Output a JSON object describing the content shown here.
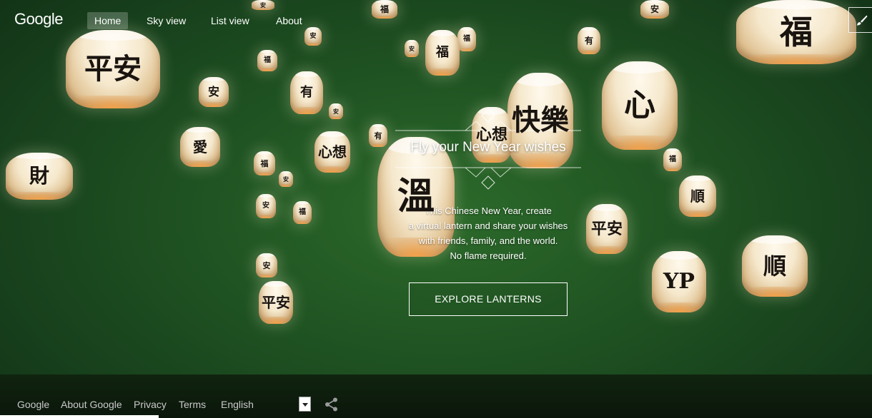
{
  "app": {
    "logo": "Google"
  },
  "nav": {
    "items": [
      {
        "label": "Home",
        "active": true
      },
      {
        "label": "Sky view",
        "active": false
      },
      {
        "label": "List view",
        "active": false
      },
      {
        "label": "About",
        "active": false
      }
    ],
    "draw_icon": "brush-icon"
  },
  "hero": {
    "title": "Fly your New Year wishes",
    "description": [
      "This Chinese New Year, create",
      "a virtual lantern and share your wishes",
      "with friends, family, and the world.",
      "No flame required."
    ],
    "cta_label": "EXPLORE LANTERNS"
  },
  "lanterns": {
    "l1": "平安",
    "l2": "福",
    "l3": "溫",
    "l4": "心",
    "l5": "YP",
    "l6": "平安",
    "l7": "順",
    "l8": "快樂",
    "l9": "福",
    "l10": "安",
    "l11": "財",
    "l12": "愛",
    "l13": "有",
    "l14": "心想",
    "l15": "平安",
    "l16": "平安",
    "l17": "福"
  },
  "footer": {
    "links": [
      "Google",
      "About Google",
      "Privacy",
      "Terms"
    ],
    "language": "English",
    "share_icon": "share-icon"
  },
  "colors": {
    "sky_center": "#2c6a2a",
    "sky_edge": "#102d14",
    "text": "#ffffff",
    "footer_text": "#c9c9c9"
  }
}
